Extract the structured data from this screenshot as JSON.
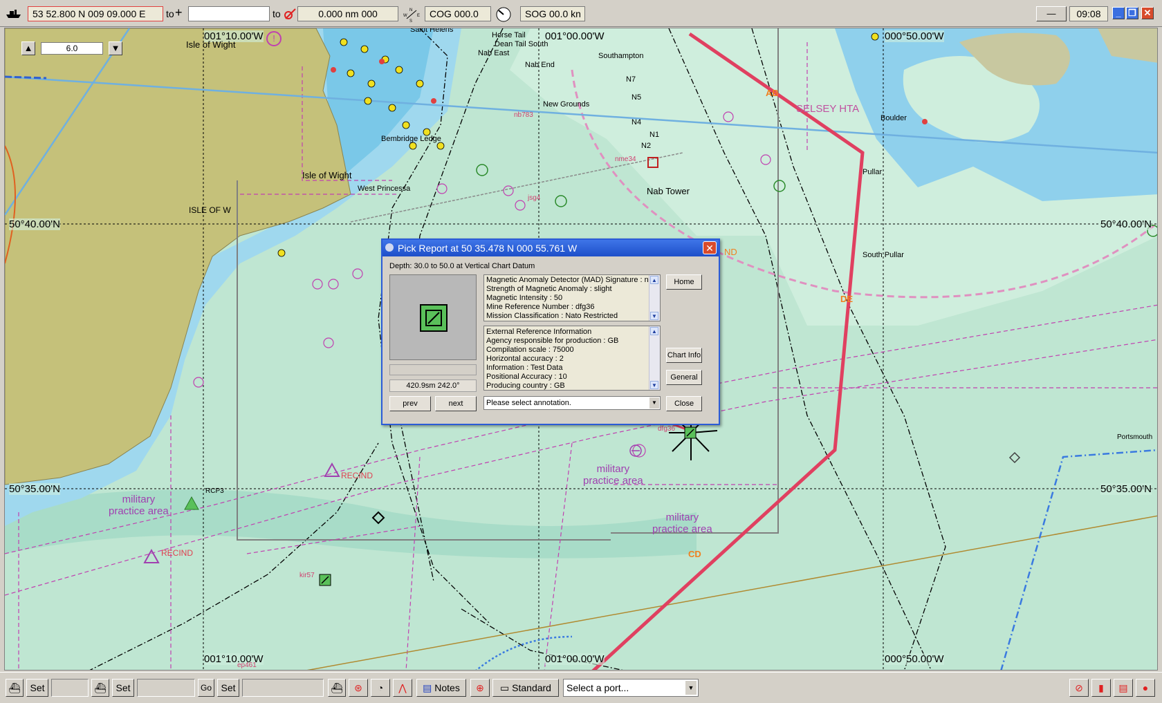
{
  "toolbar": {
    "position": "53 52.800 N   009 09.000 E",
    "to_label": "to",
    "to_field": "",
    "to2_label": "to",
    "range": "0.000 nm  000",
    "cog": "COG 000.0",
    "sog": "SOG 00.0 kn",
    "time": "09:08"
  },
  "zoom": {
    "value": "6.0"
  },
  "chart": {
    "coords": {
      "lon_top_left": "001°10.00'W",
      "lon_top_mid": "001°00.00'W",
      "lon_top_right": "000°50.00'W",
      "lon_bot_left": "001°10.00'W",
      "lon_bot_mid": "001°00.00'W",
      "lon_bot_right": "000°50.00'W",
      "lat_40_left": "50°40.00'N",
      "lat_40_right": "50°40.00'N",
      "lat_35_left": "50°35.00'N",
      "lat_35_right": "50°35.00'N"
    },
    "places": {
      "iow_top": "Isle of Wight",
      "iow_mid": "Isle of Wight",
      "iow_caps": "ISLE OF W",
      "saint_helens": "Saint Helens",
      "horse_tail": "Horse Tail",
      "dean_tail": "Dean Tail South",
      "nab_east": "Nab East",
      "nab_end": "Nab End",
      "southampton": "Southampton",
      "new_grounds": "New Grounds",
      "bembridge": "Bembridge Ledge",
      "west_princessa": "West Princessa",
      "nab_tower": "Nab Tower",
      "boulder": "Boulder",
      "pullar": "Pullar",
      "south_pullar": "South Pullar",
      "selsey": "SELSEY HTA",
      "portsmouth": "Portsmouth",
      "n7": "N7",
      "n5": "N5",
      "n4": "N4",
      "n2": "N2",
      "n1": "N1",
      "nme34": "nme34",
      "jsg": "jsg4",
      "rcp3": "RCP3",
      "dfg": "dfg36",
      "kir57": "kir57",
      "ep461": "ep461",
      "nb783": "nb783"
    },
    "areas": {
      "mil1": "military",
      "mil1b": "practice area",
      "mil2": "military",
      "mil2b": "practice area",
      "mil3": "military",
      "mil3b": "practice area",
      "recind1": "RECIND",
      "recind2": "RECIND"
    },
    "route_labels": {
      "ab": "AB",
      "de": "DE",
      "cd": "CD",
      "nd": "ND"
    }
  },
  "dialog": {
    "title": "Pick Report at 50 35.478 N 000 55.761 W",
    "depth": "Depth: 30.0 to 50.0 at Vertical Chart Datum",
    "distance": "420.9sm 242.0°",
    "list1": [
      "Magnetic Anomaly Detector (MAD) Signature : nil",
      "Strength of Magnetic Anomaly : slight",
      "Magnetic Intensity : 50",
      "Mine Reference Number : dfg36",
      "Mission Classification : Nato Restricted"
    ],
    "list2": [
      "External Reference Information",
      "Agency responsible for production : GB",
      "Compilation scale : 75000",
      "Horizontal accuracy : 2",
      "Information : Test Data",
      "Positional Accuracy : 10",
      "Producing country : GB"
    ],
    "annotation": "Please select annotation.",
    "buttons": {
      "home": "Home",
      "chart_info": "Chart Info",
      "general": "General",
      "close": "Close",
      "prev": "prev",
      "next": "next"
    }
  },
  "bottombar": {
    "set1": "Set",
    "set2": "Set",
    "go": "Go",
    "set3": "Set",
    "notes": "Notes",
    "standard": "Standard",
    "port": "Select a port..."
  }
}
